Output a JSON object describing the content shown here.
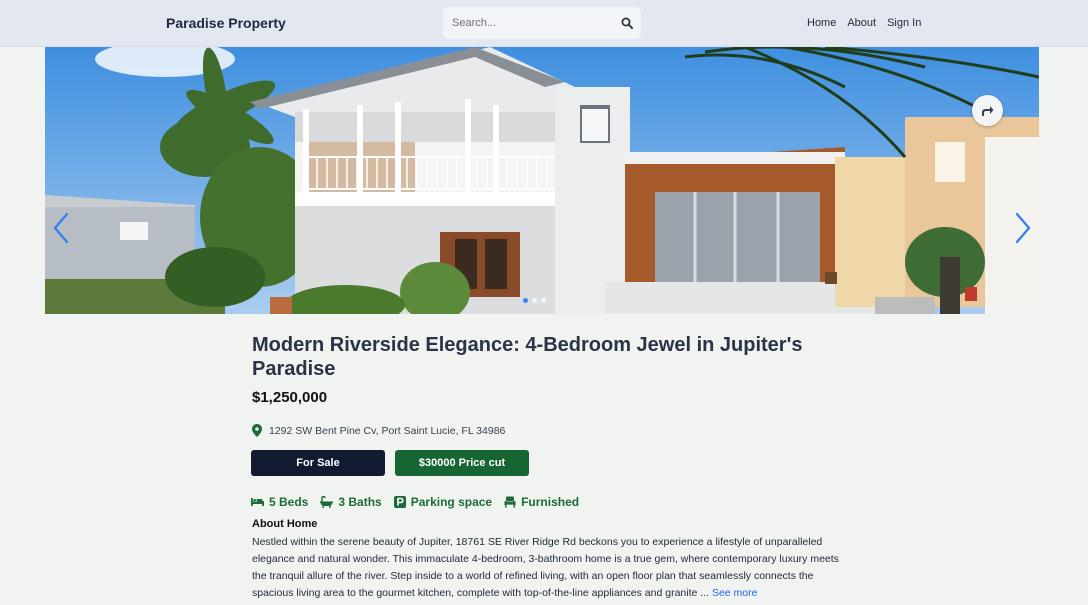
{
  "navbar": {
    "brand": "Paradise Property",
    "search_placeholder": "Search...",
    "links": [
      "Home",
      "About",
      "Sign In"
    ]
  },
  "carousel": {
    "slide_count": 3,
    "active_index": 0
  },
  "listing": {
    "title": "Modern Riverside Elegance: 4-Bedroom Jewel in Jupiter's Paradise",
    "price": "$1,250,000",
    "address": "1292 SW Bent Pine Cv, Port Saint Lucie, FL 34986",
    "status_label": "For Sale",
    "price_cut_label": "$30000 Price cut",
    "features": {
      "beds": "5 Beds",
      "baths": "3 Baths",
      "parking": "Parking space",
      "furnished": "Furnished"
    },
    "about_heading": "About Home",
    "about_text": "Nestled within the serene beauty of Jupiter, 18761 SE River Ridge Rd beckons you to experience a lifestyle of unparalleled elegance and natural wonder. This immaculate 4-bedroom, 3-bathroom home is a true gem, where contemporary luxury meets the tranquil allure of the river. Step inside to a world of refined living, with an open floor plan that seamlessly connects the spacious living area to the gourmet kitchen, complete with top-of-the-line appliances and granite ...",
    "see_more_label": "See more"
  },
  "colors": {
    "navbar_bg": "#e2e7f0",
    "page_bg": "#f0f3ef",
    "for_sale_bg": "#111a2e",
    "price_cut_bg": "#176533",
    "feature_green": "#1d6a38",
    "link_blue": "#2563eb"
  },
  "icons": [
    "search-icon",
    "chevron-left-icon",
    "chevron-right-icon",
    "share-icon",
    "map-pin-icon",
    "bed-icon",
    "bath-icon",
    "parking-icon",
    "sofa-icon"
  ]
}
